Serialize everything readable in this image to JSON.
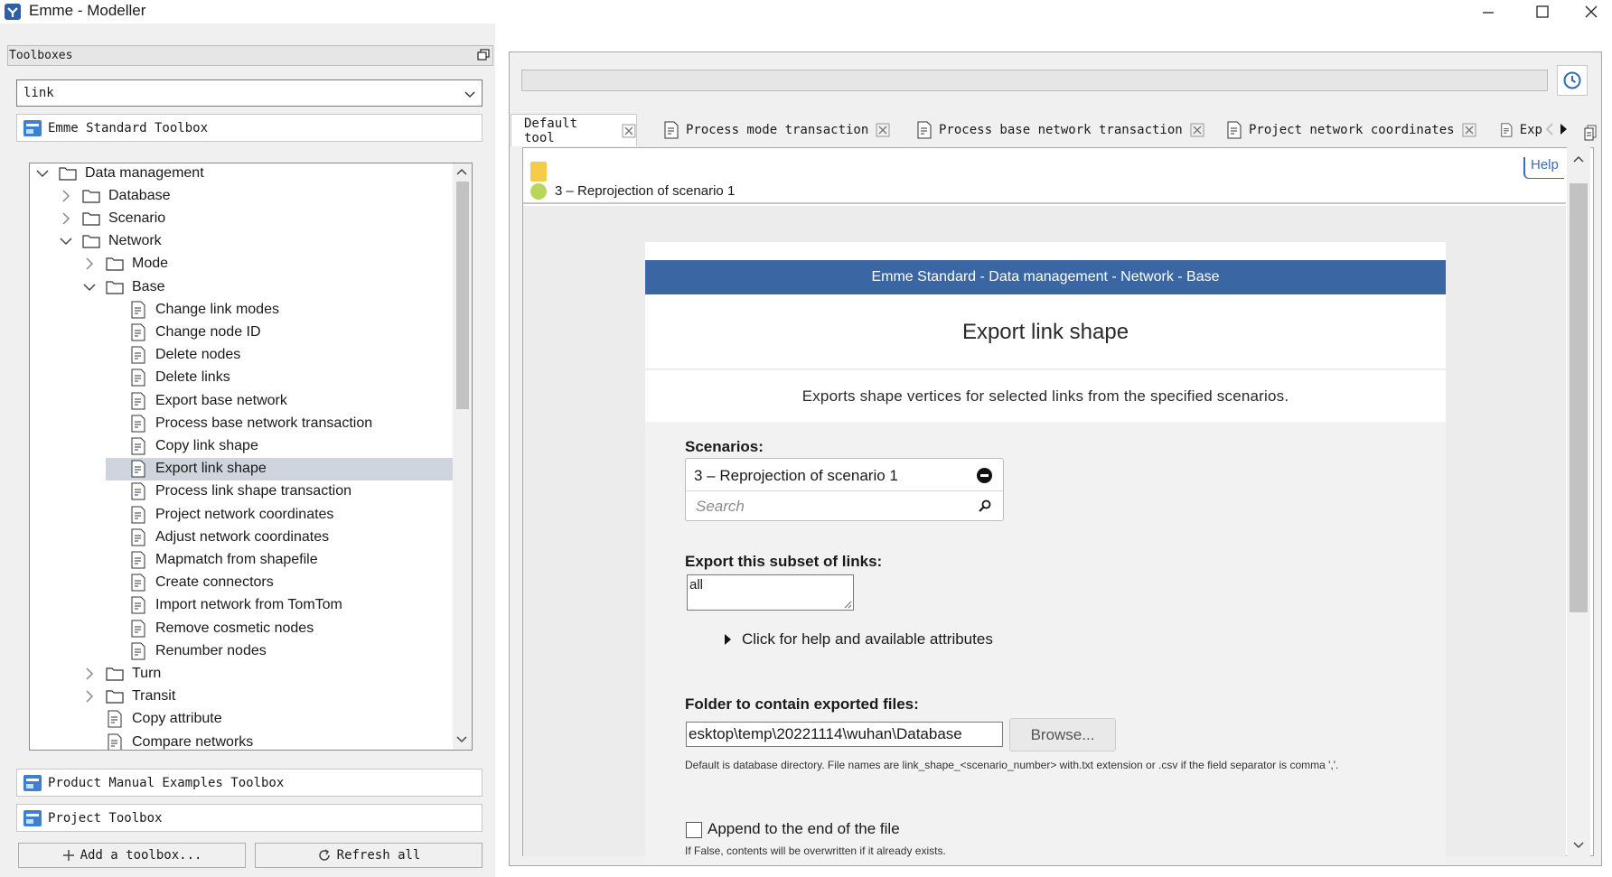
{
  "window": {
    "title": "Emme - Modeller"
  },
  "left_panel": {
    "header": "Toolboxes",
    "search_value": "link",
    "toolboxes": {
      "standard": "Emme Standard Toolbox",
      "examples": "Product Manual Examples Toolbox",
      "project": "Project Toolbox"
    },
    "tree": [
      {
        "label": "Data management",
        "type": "folder",
        "level": 0,
        "expanded": true
      },
      {
        "label": "Database",
        "type": "folder",
        "level": 1,
        "expanded": false
      },
      {
        "label": "Scenario",
        "type": "folder",
        "level": 1,
        "expanded": false
      },
      {
        "label": "Network",
        "type": "folder",
        "level": 1,
        "expanded": true
      },
      {
        "label": "Mode",
        "type": "folder",
        "level": 2,
        "expanded": false
      },
      {
        "label": "Base",
        "type": "folder",
        "level": 2,
        "expanded": true
      },
      {
        "label": "Change link modes",
        "type": "tool",
        "level": 3
      },
      {
        "label": "Change node ID",
        "type": "tool",
        "level": 3
      },
      {
        "label": "Delete nodes",
        "type": "tool",
        "level": 3
      },
      {
        "label": "Delete links",
        "type": "tool",
        "level": 3
      },
      {
        "label": "Export base network",
        "type": "tool",
        "level": 3
      },
      {
        "label": "Process base network transaction",
        "type": "tool",
        "level": 3
      },
      {
        "label": "Copy link shape",
        "type": "tool",
        "level": 3
      },
      {
        "label": "Export link shape",
        "type": "tool",
        "level": 3,
        "selected": true
      },
      {
        "label": "Process link shape transaction",
        "type": "tool",
        "level": 3
      },
      {
        "label": "Project network coordinates",
        "type": "tool",
        "level": 3
      },
      {
        "label": "Adjust network coordinates",
        "type": "tool",
        "level": 3
      },
      {
        "label": "Mapmatch from shapefile",
        "type": "tool",
        "level": 3
      },
      {
        "label": "Create connectors",
        "type": "tool",
        "level": 3
      },
      {
        "label": "Import network from TomTom",
        "type": "tool",
        "level": 3
      },
      {
        "label": "Remove cosmetic nodes",
        "type": "tool",
        "level": 3
      },
      {
        "label": "Renumber nodes",
        "type": "tool",
        "level": 3
      },
      {
        "label": "Turn",
        "type": "folder",
        "level": 2,
        "expanded": false
      },
      {
        "label": "Transit",
        "type": "folder",
        "level": 2,
        "expanded": false
      },
      {
        "label": "Copy attribute",
        "type": "tool",
        "level": 2
      },
      {
        "label": "Compare networks",
        "type": "tool",
        "level": 2
      }
    ],
    "buttons": {
      "add_toolbox": "Add a toolbox...",
      "refresh_all": "Refresh all"
    }
  },
  "tabs": [
    {
      "label": "Default tool",
      "doc_icon": false
    },
    {
      "label": "Process mode transaction",
      "doc_icon": true
    },
    {
      "label": "Process base network transaction",
      "doc_icon": true
    },
    {
      "label": "Project network coordinates",
      "doc_icon": true
    },
    {
      "label": "Exp",
      "doc_icon": true
    }
  ],
  "job": {
    "label": "3 – Reprojection of scenario 1",
    "help": "Help"
  },
  "tool": {
    "banner": "Emme Standard - Data management - Network - Base",
    "title": "Export link shape",
    "description": "Exports shape vertices for selected links from the specified scenarios.",
    "scenarios_label": "Scenarios:",
    "scenario_selected": "3 – Reprojection of scenario 1",
    "scenario_search_placeholder": "Search",
    "subset_label": "Export this subset of links:",
    "subset_value": "all",
    "help_toggle": "Click for help and available attributes",
    "folder_label": "Folder to contain exported files:",
    "folder_value": "esktop\\temp\\20221114\\wuhan\\Database",
    "browse": "Browse...",
    "folder_help": "Default is database directory. File names are link_shape_<scenario_number> with.txt extension or .csv if the field separator is comma ','.",
    "append_label": "Append to the end of the file",
    "append_help": "If False, contents will be overwritten if it already exists."
  },
  "colors": {
    "banner": "#3a67a3",
    "selection": "#cfd5dd",
    "status_dot": "#b7d65a",
    "help_accent": "#3b6db3"
  }
}
